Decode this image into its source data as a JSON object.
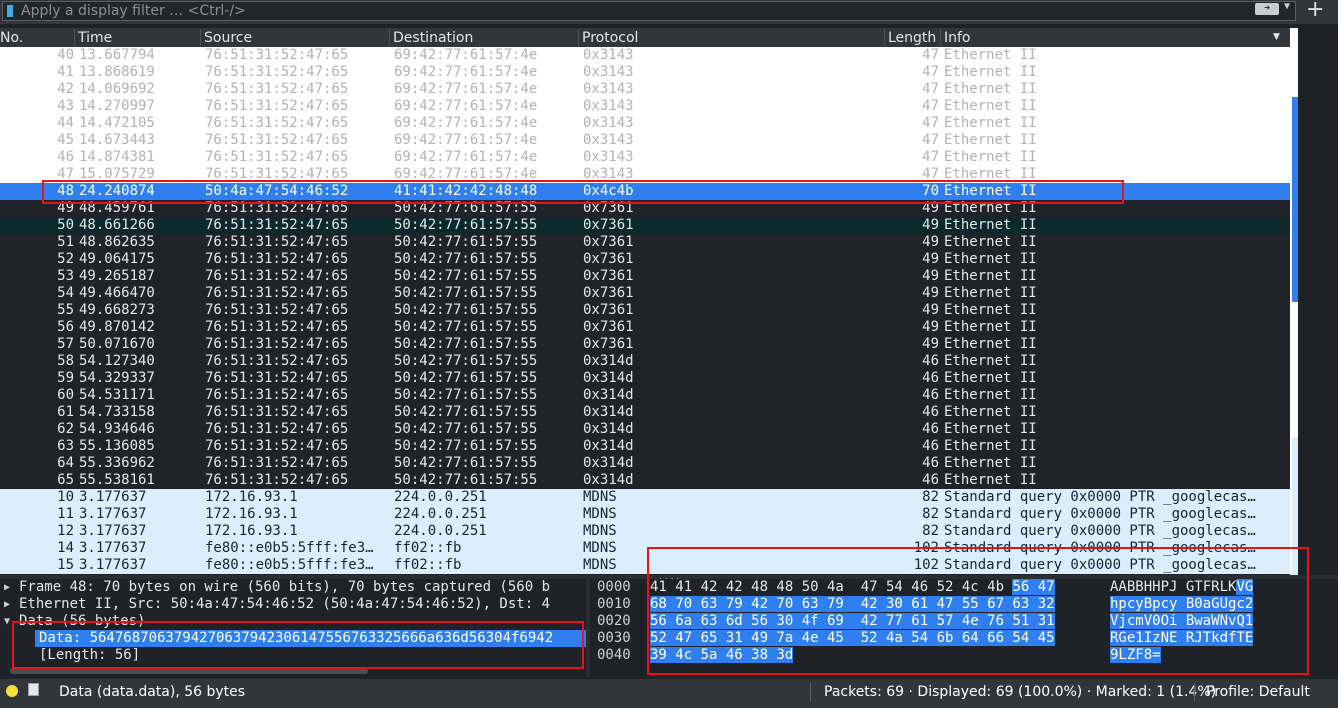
{
  "filter": {
    "placeholder": "Apply a display filter … <Ctrl-/>",
    "apply_icon": "arrow-right-icon",
    "add_icon": "plus-icon"
  },
  "columns": {
    "no": "No.",
    "time": "Time",
    "source": "Source",
    "destination": "Destination",
    "protocol": "Protocol",
    "length": "Length",
    "info": "Info"
  },
  "packets": [
    {
      "no": "40",
      "time": "13.667794",
      "src": "76:51:31:52:47:65",
      "dst": "69:42:77:61:57:4e",
      "proto": "0x3143",
      "len": "47",
      "info": "Ethernet II",
      "scheme": "light"
    },
    {
      "no": "41",
      "time": "13.868619",
      "src": "76:51:31:52:47:65",
      "dst": "69:42:77:61:57:4e",
      "proto": "0x3143",
      "len": "47",
      "info": "Ethernet II",
      "scheme": "light"
    },
    {
      "no": "42",
      "time": "14.069692",
      "src": "76:51:31:52:47:65",
      "dst": "69:42:77:61:57:4e",
      "proto": "0x3143",
      "len": "47",
      "info": "Ethernet II",
      "scheme": "light"
    },
    {
      "no": "43",
      "time": "14.270997",
      "src": "76:51:31:52:47:65",
      "dst": "69:42:77:61:57:4e",
      "proto": "0x3143",
      "len": "47",
      "info": "Ethernet II",
      "scheme": "light"
    },
    {
      "no": "44",
      "time": "14.472105",
      "src": "76:51:31:52:47:65",
      "dst": "69:42:77:61:57:4e",
      "proto": "0x3143",
      "len": "47",
      "info": "Ethernet II",
      "scheme": "light"
    },
    {
      "no": "45",
      "time": "14.673443",
      "src": "76:51:31:52:47:65",
      "dst": "69:42:77:61:57:4e",
      "proto": "0x3143",
      "len": "47",
      "info": "Ethernet II",
      "scheme": "light"
    },
    {
      "no": "46",
      "time": "14.874381",
      "src": "76:51:31:52:47:65",
      "dst": "69:42:77:61:57:4e",
      "proto": "0x3143",
      "len": "47",
      "info": "Ethernet II",
      "scheme": "light"
    },
    {
      "no": "47",
      "time": "15.075729",
      "src": "76:51:31:52:47:65",
      "dst": "69:42:77:61:57:4e",
      "proto": "0x3143",
      "len": "47",
      "info": "Ethernet II",
      "scheme": "light"
    },
    {
      "no": "48",
      "time": "24.240874",
      "src": "50:4a:47:54:46:52",
      "dst": "41:41:42:42:48:48",
      "proto": "0x4c4b",
      "len": "70",
      "info": "Ethernet II",
      "scheme": "sel"
    },
    {
      "no": "49",
      "time": "48.459761",
      "src": "76:51:31:52:47:65",
      "dst": "50:42:77:61:57:55",
      "proto": "0x7361",
      "len": "49",
      "info": "Ethernet II",
      "scheme": "dark"
    },
    {
      "no": "50",
      "time": "48.661266",
      "src": "76:51:31:52:47:65",
      "dst": "50:42:77:61:57:55",
      "proto": "0x7361",
      "len": "49",
      "info": "Ethernet II",
      "scheme": "teal"
    },
    {
      "no": "51",
      "time": "48.862635",
      "src": "76:51:31:52:47:65",
      "dst": "50:42:77:61:57:55",
      "proto": "0x7361",
      "len": "49",
      "info": "Ethernet II",
      "scheme": "dark"
    },
    {
      "no": "52",
      "time": "49.064175",
      "src": "76:51:31:52:47:65",
      "dst": "50:42:77:61:57:55",
      "proto": "0x7361",
      "len": "49",
      "info": "Ethernet II",
      "scheme": "dark"
    },
    {
      "no": "53",
      "time": "49.265187",
      "src": "76:51:31:52:47:65",
      "dst": "50:42:77:61:57:55",
      "proto": "0x7361",
      "len": "49",
      "info": "Ethernet II",
      "scheme": "dark"
    },
    {
      "no": "54",
      "time": "49.466470",
      "src": "76:51:31:52:47:65",
      "dst": "50:42:77:61:57:55",
      "proto": "0x7361",
      "len": "49",
      "info": "Ethernet II",
      "scheme": "dark"
    },
    {
      "no": "55",
      "time": "49.668273",
      "src": "76:51:31:52:47:65",
      "dst": "50:42:77:61:57:55",
      "proto": "0x7361",
      "len": "49",
      "info": "Ethernet II",
      "scheme": "dark"
    },
    {
      "no": "56",
      "time": "49.870142",
      "src": "76:51:31:52:47:65",
      "dst": "50:42:77:61:57:55",
      "proto": "0x7361",
      "len": "49",
      "info": "Ethernet II",
      "scheme": "dark"
    },
    {
      "no": "57",
      "time": "50.071670",
      "src": "76:51:31:52:47:65",
      "dst": "50:42:77:61:57:55",
      "proto": "0x7361",
      "len": "49",
      "info": "Ethernet II",
      "scheme": "dark"
    },
    {
      "no": "58",
      "time": "54.127340",
      "src": "76:51:31:52:47:65",
      "dst": "50:42:77:61:57:55",
      "proto": "0x314d",
      "len": "46",
      "info": "Ethernet II",
      "scheme": "dark"
    },
    {
      "no": "59",
      "time": "54.329337",
      "src": "76:51:31:52:47:65",
      "dst": "50:42:77:61:57:55",
      "proto": "0x314d",
      "len": "46",
      "info": "Ethernet II",
      "scheme": "dark"
    },
    {
      "no": "60",
      "time": "54.531171",
      "src": "76:51:31:52:47:65",
      "dst": "50:42:77:61:57:55",
      "proto": "0x314d",
      "len": "46",
      "info": "Ethernet II",
      "scheme": "dark"
    },
    {
      "no": "61",
      "time": "54.733158",
      "src": "76:51:31:52:47:65",
      "dst": "50:42:77:61:57:55",
      "proto": "0x314d",
      "len": "46",
      "info": "Ethernet II",
      "scheme": "dark"
    },
    {
      "no": "62",
      "time": "54.934646",
      "src": "76:51:31:52:47:65",
      "dst": "50:42:77:61:57:55",
      "proto": "0x314d",
      "len": "46",
      "info": "Ethernet II",
      "scheme": "dark"
    },
    {
      "no": "63",
      "time": "55.136085",
      "src": "76:51:31:52:47:65",
      "dst": "50:42:77:61:57:55",
      "proto": "0x314d",
      "len": "46",
      "info": "Ethernet II",
      "scheme": "dark"
    },
    {
      "no": "64",
      "time": "55.336962",
      "src": "76:51:31:52:47:65",
      "dst": "50:42:77:61:57:55",
      "proto": "0x314d",
      "len": "46",
      "info": "Ethernet II",
      "scheme": "dark"
    },
    {
      "no": "65",
      "time": "55.538161",
      "src": "76:51:31:52:47:65",
      "dst": "50:42:77:61:57:55",
      "proto": "0x314d",
      "len": "46",
      "info": "Ethernet II",
      "scheme": "dark"
    },
    {
      "no": "10",
      "time": "3.177637",
      "src": "172.16.93.1",
      "dst": "224.0.0.251",
      "proto": "MDNS",
      "len": "82",
      "info": "Standard query 0x0000 PTR _googlecas…",
      "scheme": "mdns"
    },
    {
      "no": "11",
      "time": "3.177637",
      "src": "172.16.93.1",
      "dst": "224.0.0.251",
      "proto": "MDNS",
      "len": "82",
      "info": "Standard query 0x0000 PTR _googlecas…",
      "scheme": "mdns"
    },
    {
      "no": "12",
      "time": "3.177637",
      "src": "172.16.93.1",
      "dst": "224.0.0.251",
      "proto": "MDNS",
      "len": "82",
      "info": "Standard query 0x0000 PTR _googlecas…",
      "scheme": "mdns"
    },
    {
      "no": "14",
      "time": "3.177637",
      "src": "fe80::e0b5:5fff:fe3…",
      "dst": "ff02::fb",
      "proto": "MDNS",
      "len": "102",
      "info": "Standard query 0x0000 PTR _googlecas…",
      "scheme": "mdns"
    },
    {
      "no": "15",
      "time": "3.177637",
      "src": "fe80::e0b5:5fff:fe3…",
      "dst": "ff02::fb",
      "proto": "MDNS",
      "len": "102",
      "info": "Standard query 0x0000 PTR _googlecas…",
      "scheme": "mdns"
    }
  ],
  "details": [
    {
      "arrow": "▶",
      "text": "Frame 48: 70 bytes on wire (560 bits), 70 bytes captured (560 b",
      "indent": 0,
      "selected": false
    },
    {
      "arrow": "▶",
      "text": "Ethernet II, Src: 50:4a:47:54:46:52 (50:4a:47:54:46:52), Dst: 4",
      "indent": 0,
      "selected": false
    },
    {
      "arrow": "▼",
      "text": "Data (56 bytes)",
      "indent": 0,
      "selected": false
    },
    {
      "arrow": "",
      "text": "Data: 5647687063794270637942306147556763325666a636d56304f6942",
      "indent": 1,
      "selected": true
    },
    {
      "arrow": "",
      "text": "[Length: 56]",
      "indent": 1,
      "selected": false
    }
  ],
  "bytes": [
    {
      "offset": "0000",
      "hex_plain": "41 41 42 42 48 48 50 4a  47 54 46 52 4c 4b ",
      "hex_hl": "56 47",
      "ascii_plain": "AABBHHPJ GTFRLK",
      "ascii_hl": "VG"
    },
    {
      "offset": "0010",
      "hex_plain": "",
      "hex_hl": "68 70 63 79 42 70 63 79  42 30 61 47 55 67 63 32",
      "ascii_plain": "",
      "ascii_hl": "hpcyBpcy B0aGUgc2"
    },
    {
      "offset": "0020",
      "hex_plain": "",
      "hex_hl": "56 6a 63 6d 56 30 4f 69  42 77 61 57 4e 76 51 31",
      "ascii_plain": "",
      "ascii_hl": "VjcmV0Oi BwaWNvQ1"
    },
    {
      "offset": "0030",
      "hex_plain": "",
      "hex_hl": "52 47 65 31 49 7a 4e 45  52 4a 54 6b 64 66 54 45",
      "ascii_plain": "",
      "ascii_hl": "RGe1IzNE RJTkdfTE"
    },
    {
      "offset": "0040",
      "hex_plain": "",
      "hex_hl": "39 4c 5a 46 38 3d",
      "ascii_plain": "",
      "ascii_hl": "9LZF8="
    }
  ],
  "status": {
    "field": "Data (data.data), 56 bytes",
    "packets": "Packets: 69 · Displayed: 69 (100.0%) · Marked: 1 (1.4%)",
    "profile": "Profile: Default"
  },
  "colors": {
    "selection": "#2f7ff0",
    "annotation": "#e8121a",
    "mdns_row": "#daeeff",
    "dark_row": "#20242a"
  }
}
